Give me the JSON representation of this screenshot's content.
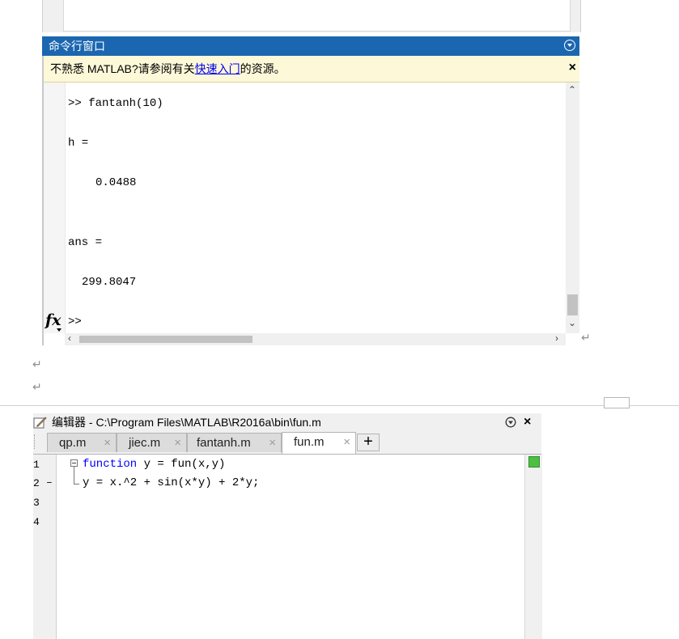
{
  "command_window": {
    "title": "命令行窗口",
    "notice_prefix": "不熟悉 MATLAB?请参阅有关",
    "notice_link": "快速入门",
    "notice_suffix": "的资源。",
    "close_glyph": "×",
    "lines": [
      ">> fantanh(10)",
      "h =",
      "0.0488",
      "ans =",
      "299.8047",
      ">>"
    ],
    "fx_label": "fx"
  },
  "return_mark": "↵",
  "editor": {
    "title": "编辑器 - C:\\Program Files\\MATLAB\\R2016a\\bin\\fun.m",
    "tabs": [
      {
        "label": "qp.m"
      },
      {
        "label": "jiec.m"
      },
      {
        "label": "fantanh.m"
      },
      {
        "label": "fun.m",
        "active": true
      }
    ],
    "tab_close_glyph": "×",
    "add_tab_glyph": "+",
    "line_numbers": [
      "1",
      "2",
      "3",
      "4"
    ],
    "line2_marker": "–",
    "code_keyword": "function",
    "code_line1_rest": " y = fun(x,y)",
    "code_line2": "y = x.^2 + sin(x*y) + 2*y;",
    "status_color": "#4fbf3f"
  },
  "colors": {
    "title_bar": "#1b66b0",
    "notice_bg": "#fcf8d8",
    "keyword": "#0000ff",
    "link": "#0000ee"
  }
}
